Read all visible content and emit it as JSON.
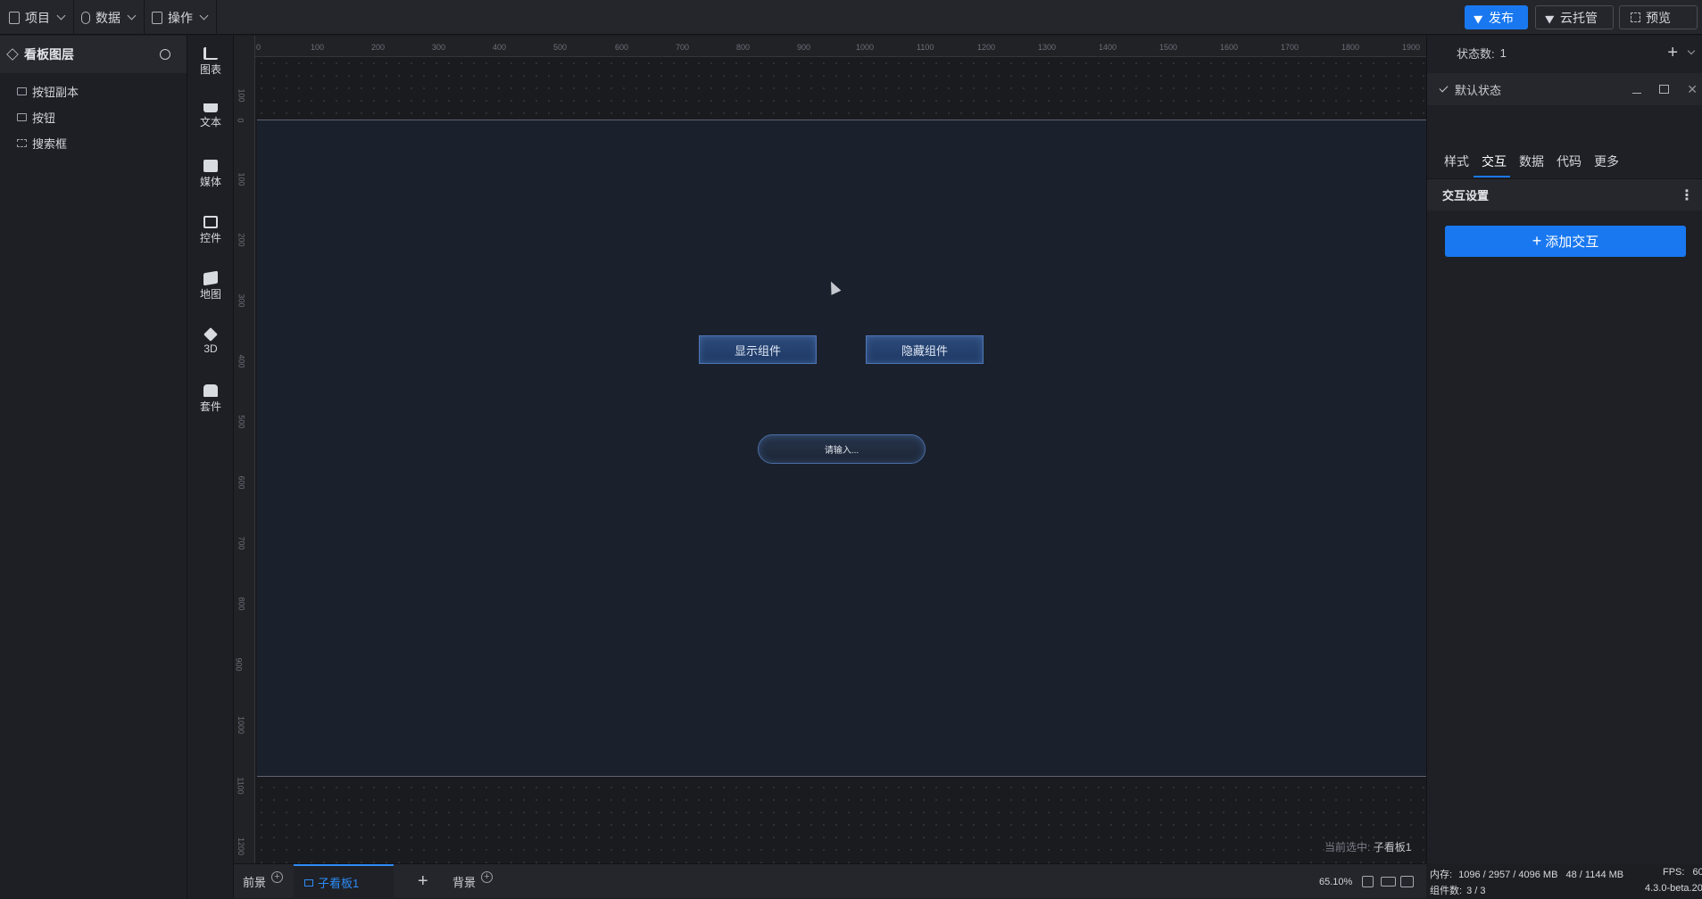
{
  "menus": [
    {
      "label": "项目",
      "icon": "file-icon"
    },
    {
      "label": "数据",
      "icon": "database-icon"
    },
    {
      "label": "操作",
      "icon": "grid-icon"
    }
  ],
  "top_actions": {
    "publish": "发布",
    "cloud": "云托管",
    "preview": "预览"
  },
  "layers": {
    "title": "看板图层",
    "items": [
      "按钮副本",
      "按钮",
      "搜索框"
    ]
  },
  "components": [
    "图表",
    "文本",
    "媒体",
    "控件",
    "地图",
    "3D",
    "套件"
  ],
  "ruler": {
    "h": [
      "0",
      "100",
      "200",
      "300",
      "400",
      "500",
      "600",
      "700",
      "800",
      "900",
      "1000",
      "1100",
      "1200",
      "1300",
      "1400",
      "1500",
      "1600",
      "1700",
      "1800",
      "1900"
    ],
    "v": [
      "100",
      "0",
      "100",
      "200",
      "300",
      "400",
      "500",
      "600",
      "700",
      "800",
      "900",
      "1000",
      "1100",
      "1200"
    ]
  },
  "canvas": {
    "show_button": "显示组件",
    "hide_button": "隐藏组件",
    "search_placeholder": "请输入...",
    "selected_label": "当前选中:",
    "selected_value": "子看板1"
  },
  "bottom": {
    "foreground": "前景",
    "sub_board": "子看板1",
    "background": "背景",
    "zoom": "65.10%"
  },
  "right_panel": {
    "state_count_label": "状态数:",
    "state_count": "1",
    "default_state": "默认状态",
    "tabs": [
      "样式",
      "交互",
      "数据",
      "代码",
      "更多"
    ],
    "active_tab": "交互",
    "section_title": "交互设置",
    "add_interaction": "添加交互"
  },
  "status": {
    "memory_label": "内存:",
    "memory": "1096 / 2957 / 4096 MB",
    "memory2": "48 / 1144 MB",
    "fps_label": "FPS:",
    "fps": "60",
    "count_label": "组件数:",
    "count": "3 / 3",
    "version": "4.3.0-beta.20"
  },
  "colors": {
    "accent": "#1978f0",
    "board": "#1b212c",
    "button_bg": "#2c4a7a"
  }
}
